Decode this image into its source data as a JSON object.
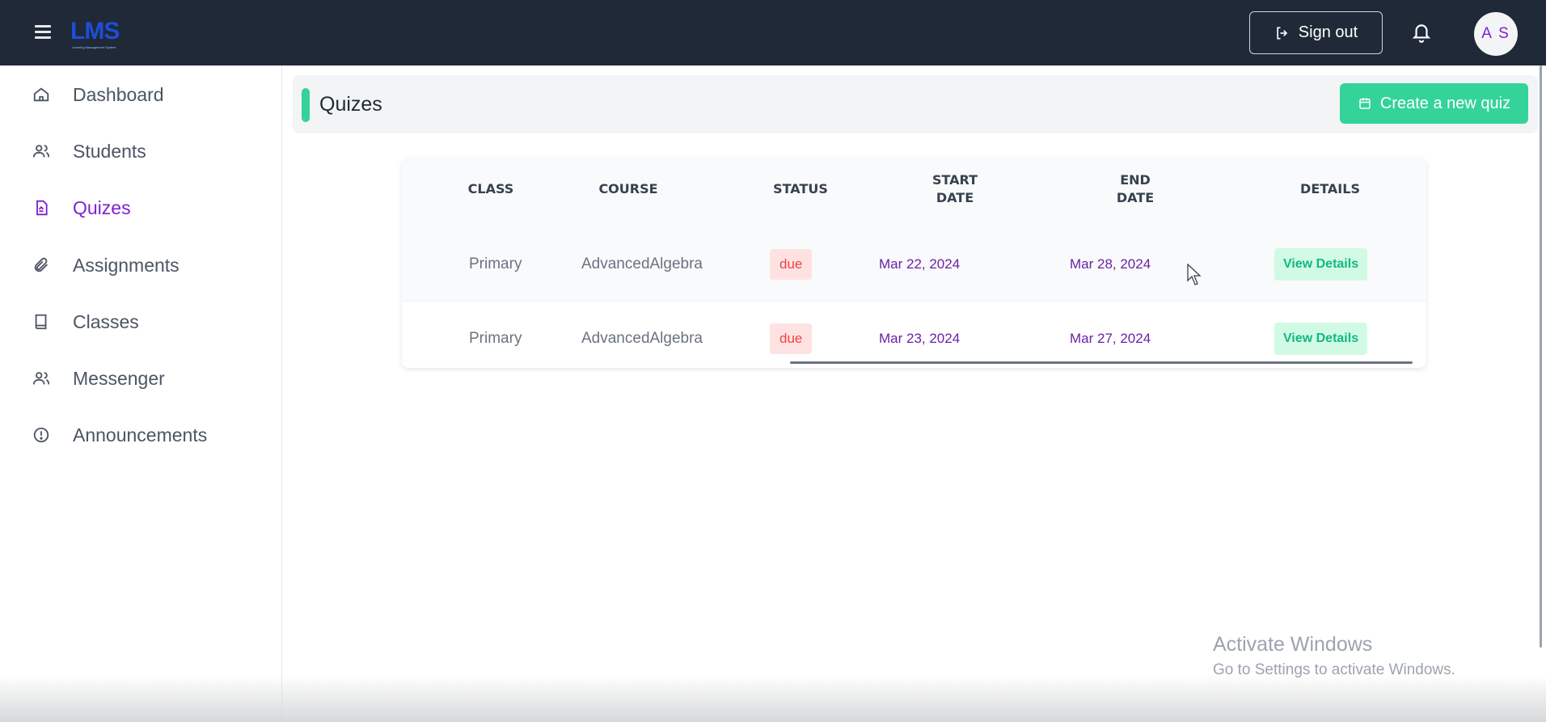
{
  "app": {
    "logo_text": "LMS",
    "logo_subtext": "Learning Management System"
  },
  "topbar": {
    "signout_label": "Sign out",
    "avatar_initials": "A S"
  },
  "sidebar": {
    "items": [
      {
        "label": "Dashboard",
        "icon": "home-icon",
        "active": false
      },
      {
        "label": "Students",
        "icon": "users-icon",
        "active": false
      },
      {
        "label": "Quizes",
        "icon": "document-icon",
        "active": true
      },
      {
        "label": "Assignments",
        "icon": "paperclip-icon",
        "active": false
      },
      {
        "label": "Classes",
        "icon": "book-icon",
        "active": false
      },
      {
        "label": "Messenger",
        "icon": "users-icon",
        "active": false
      },
      {
        "label": "Announcements",
        "icon": "alert-circle-icon",
        "active": false
      }
    ]
  },
  "main": {
    "title": "Quizes",
    "create_button_label": "Create a new quiz",
    "table": {
      "headers": {
        "class": "CLASS",
        "course": "COURSE",
        "status": "STATUS",
        "start_date_1": "START",
        "start_date_2": "DATE",
        "end_date_1": "END",
        "end_date_2": "DATE",
        "details": "DETAILS"
      },
      "rows": [
        {
          "class": "Primary",
          "course": "AdvancedAlgebra",
          "status": "due",
          "start_date": "Mar 22, 2024",
          "end_date": "Mar 28, 2024",
          "details": "View Details"
        },
        {
          "class": "Primary",
          "course": "AdvancedAlgebra",
          "status": "due",
          "start_date": "Mar 23, 2024",
          "end_date": "Mar 27, 2024",
          "details": "View Details"
        }
      ]
    }
  },
  "watermark": {
    "line1": "Activate Windows",
    "line2": "Go to Settings to activate Windows."
  },
  "colors": {
    "topbar": "#1f2937",
    "accent_green": "#34d399",
    "active_purple": "#7e22ce",
    "status_red": "#ef4444"
  }
}
